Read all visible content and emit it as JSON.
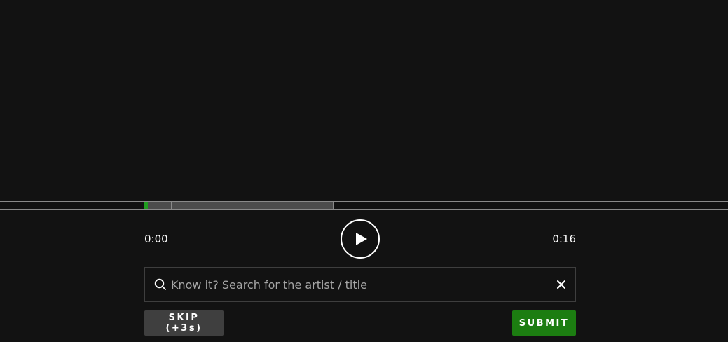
{
  "player": {
    "current_time": "0:00",
    "total_time": "0:16",
    "progress_fraction": 0,
    "segments_seconds": [
      1,
      1,
      2,
      3,
      4,
      5
    ],
    "revealed_segments": 4
  },
  "search": {
    "placeholder": "Know it? Search for the artist / title",
    "value": ""
  },
  "actions": {
    "skip_label": "SKIP (+3s)",
    "submit_label": "SUBMIT"
  },
  "colors": {
    "background": "#121212",
    "accent_green": "#1c7d11",
    "playhead_green": "#1f9e1f",
    "played_segment": "#4c4c4c",
    "skip_button": "#3f3f3f"
  },
  "icons": {
    "play": "play-icon",
    "search": "search-icon",
    "clear": "close-icon"
  }
}
